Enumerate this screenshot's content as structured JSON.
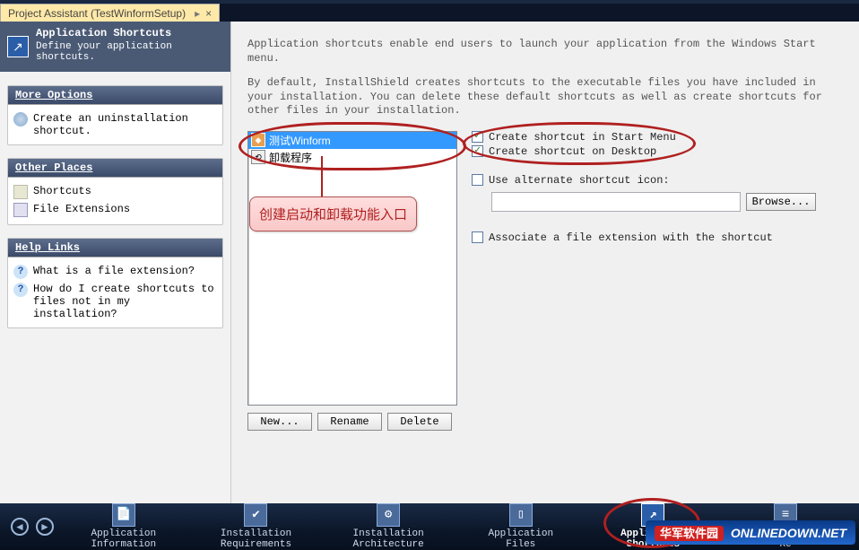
{
  "tab": {
    "title": "Project Assistant (TestWinformSetup)",
    "pin_glyph": "▸",
    "close_glyph": "×"
  },
  "header": {
    "title": "Application Shortcuts",
    "desc": "Define your application shortcuts.",
    "icon_glyph": "↗"
  },
  "sidebar": {
    "panels": [
      {
        "title": "More Options",
        "items": [
          {
            "label": "Create an uninstallation shortcut.",
            "icon": "gear"
          }
        ]
      },
      {
        "title": "Other Places",
        "items": [
          {
            "label": "Shortcuts",
            "icon": "shortcut"
          },
          {
            "label": "File Extensions",
            "icon": "fileext"
          }
        ]
      },
      {
        "title": "Help Links",
        "items": [
          {
            "label": "What is a file extension?",
            "icon": "help",
            "glyph": "?"
          },
          {
            "label": "How do I create shortcuts to files not in my installation?",
            "icon": "help",
            "glyph": "?"
          }
        ]
      }
    ]
  },
  "intro": {
    "line1": "Application shortcuts enable end users to launch your application from the Windows Start menu.",
    "line2": "By default, InstallShield creates shortcuts to the executable files you have included in your installation. You can delete these default shortcuts as well as create shortcuts for other files in your installation."
  },
  "shortcut_list": [
    {
      "label": "测试Winform",
      "selected": true
    },
    {
      "label": "卸载程序",
      "selected": false
    }
  ],
  "buttons": {
    "new": "New...",
    "rename": "Rename",
    "delete": "Delete",
    "browse": "Browse..."
  },
  "options": {
    "start_menu": {
      "label": "Create shortcut in Start Menu",
      "checked": true
    },
    "desktop": {
      "label": "Create shortcut on Desktop",
      "checked": true
    },
    "alt_icon": {
      "label": "Use alternate shortcut icon:",
      "checked": false,
      "value": ""
    },
    "assoc": {
      "label": "Associate a file extension with the shortcut",
      "checked": false
    }
  },
  "annotations": {
    "callout": "创建启动和卸载功能入口"
  },
  "bottom_nav": {
    "back_glyph": "◄",
    "forward_glyph": "►",
    "items": [
      {
        "label": "Application\nInformation",
        "glyph": "📄"
      },
      {
        "label": "Installation\nRequirements",
        "glyph": "✔"
      },
      {
        "label": "Installation\nArchitecture",
        "glyph": "⚙"
      },
      {
        "label": "Application\nFiles",
        "glyph": "▯"
      },
      {
        "label": "Application\nShortcuts",
        "glyph": "↗",
        "active": true
      },
      {
        "label": "Appl\nRe",
        "glyph": "≡"
      }
    ]
  },
  "watermark": {
    "cn": "华军软件园",
    "en": "ONLINEDOWN.NET"
  }
}
